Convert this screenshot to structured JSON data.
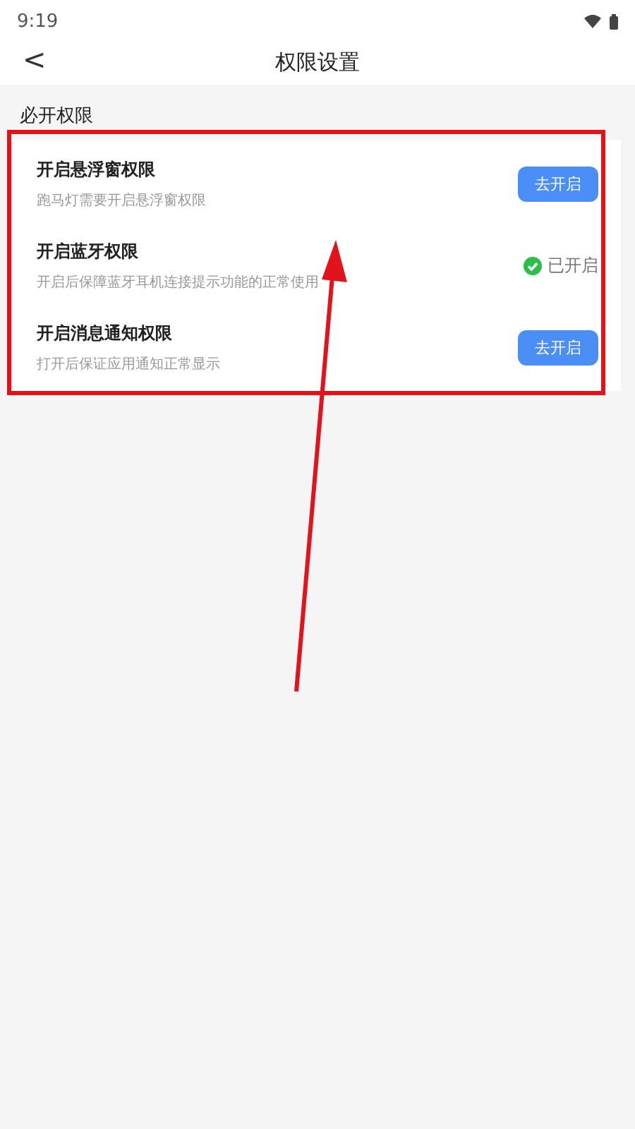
{
  "status_bar": {
    "time": "9:19"
  },
  "header": {
    "back": "<",
    "title": "权限设置"
  },
  "section": {
    "title": "必开权限",
    "items": [
      {
        "title": "开启悬浮窗权限",
        "description": "跑马灯需要开启悬浮窗权限",
        "granted": false,
        "action": "去开启"
      },
      {
        "title": "开启蓝牙权限",
        "description": "开启后保障蓝牙耳机连接提示功能的正常使用",
        "granted": true,
        "action": "已开启"
      },
      {
        "title": "开启消息通知权限",
        "description": "打开后保证应用通知正常显示",
        "granted": false,
        "action": "去开启"
      }
    ]
  }
}
